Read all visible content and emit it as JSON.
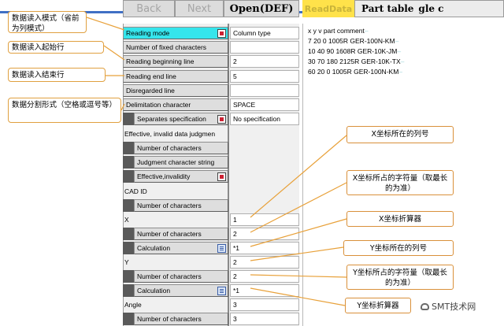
{
  "toolbar": {
    "back": "Back",
    "next": "Next",
    "open": "Open(DEF)",
    "highlight": "ReadData",
    "part_table": "Part table",
    "cut_tail": "gle c"
  },
  "settings": {
    "reading_mode": {
      "label": "Reading mode",
      "value": "Column type"
    },
    "fixed_chars": {
      "label": "Number of fixed characters"
    },
    "begin_line": {
      "label": "Reading beginning line",
      "value": "2"
    },
    "end_line": {
      "label": "Reading end line",
      "value": "5"
    },
    "disregarded": {
      "label": "Disregarded line"
    },
    "delimitation": {
      "label": "Delimitation character",
      "value": "SPACE"
    },
    "separates": {
      "label": "Separates specification",
      "value": "No specification"
    },
    "invalid_data": {
      "label": "Effective, invalid data judgmen"
    },
    "num_chars_1": {
      "label": "Number of characters"
    },
    "judgment_str": {
      "label": "Judgment character string"
    },
    "eff_invalid": {
      "label": "Effective,invalidity"
    },
    "cad_id": {
      "label": "CAD ID"
    },
    "num_chars_2": {
      "label": "Number of characters"
    },
    "x": {
      "label": "X",
      "value": "1"
    },
    "x_num_chars": {
      "label": "Number of characters",
      "value": "2"
    },
    "x_calc": {
      "label": "Calculation",
      "value": "*1"
    },
    "y": {
      "label": "Y",
      "value": "2"
    },
    "y_num_chars": {
      "label": "Number of characters",
      "value": "2"
    },
    "y_calc": {
      "label": "Calculation",
      "value": "*1"
    },
    "angle": {
      "label": "Angle",
      "value": "3"
    },
    "angle_num_chars": {
      "label": "Number of characters",
      "value": "3"
    }
  },
  "text_content": {
    "lines": [
      "x  y  v part   comment",
      "7 20 0 1005R GER-100N-KM",
      "10 40 90 1608R GER-10K-JM",
      "30 70 180 2125R GER-10K-TX",
      "60 20 0 1005R GER-100N-KM"
    ]
  },
  "callouts_left": [
    "数据读入模式（省前为列模式）",
    "数据读入起始行",
    "数据读入结束行",
    "数据分割形式（空格或逗号等）"
  ],
  "callouts_right": [
    "X坐标所在的列号",
    "X坐标所占的字符量（取最长的为准）",
    "X坐标折算器",
    "Y坐标所在的列号",
    "Y坐标所占的字符量（取最长的为准）",
    "Y坐标折算器"
  ],
  "watermark": "SMT技术网",
  "colors": {
    "accent_cyan": "#35e5ec",
    "highlight_yellow": "#ffe24a",
    "callout_border": "#e0a040",
    "top_rule": "#3f6fc4"
  }
}
